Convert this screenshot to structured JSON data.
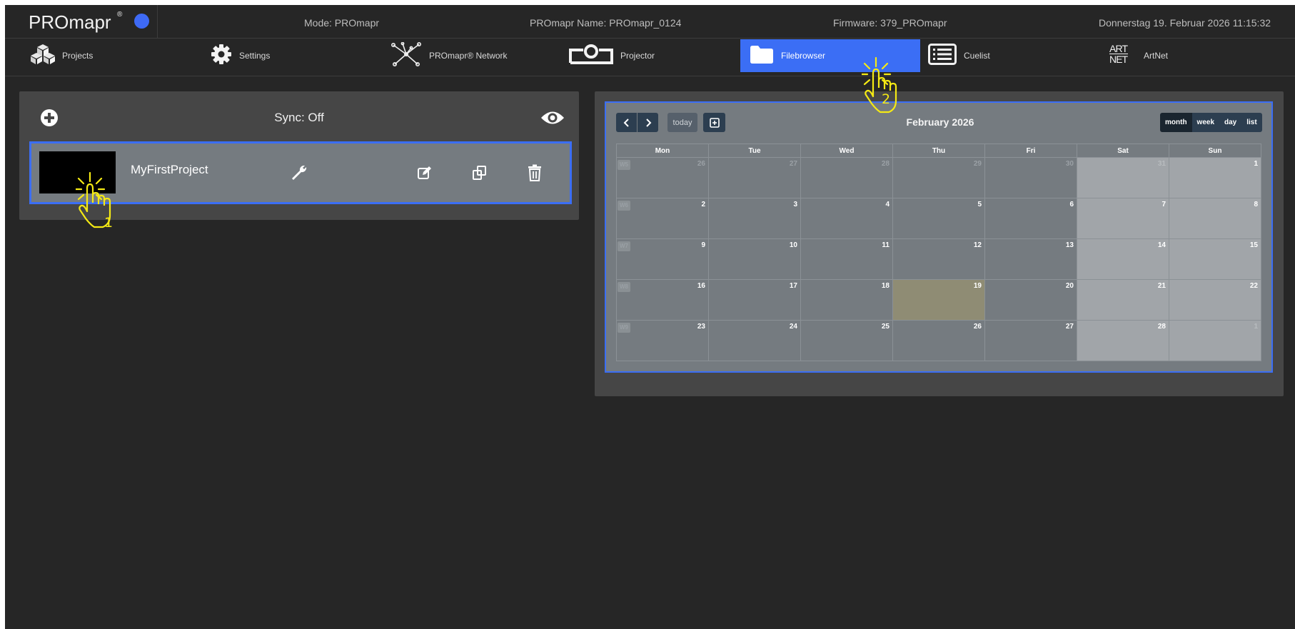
{
  "header": {
    "logo": "PROmapr",
    "logo_mark": "®",
    "mode": "Mode: PROmapr",
    "name": "PROmapr Name: PROmapr_0124",
    "firmware": "Firmware: 379_PROmapr",
    "datetime": "Donnerstag 19. Februar 2026 11:15:32",
    "status_color": "#3e6af5"
  },
  "nav": {
    "active": "Filebrowser",
    "items": [
      {
        "label": "Projects",
        "icon": "cubes-icon"
      },
      {
        "label": "Settings",
        "icon": "gear-icon"
      },
      {
        "label": "PROmapr® Network",
        "icon": "network-icon"
      },
      {
        "label": "Projector",
        "icon": "projector-icon"
      },
      {
        "label": "Filebrowser",
        "icon": "folder-icon"
      },
      {
        "label": "Cuelist",
        "icon": "list-icon"
      },
      {
        "label": "ArtNet",
        "icon": "artnet-icon"
      }
    ],
    "artnet_logo": "ART NET"
  },
  "projects": {
    "sync_label": "Sync: Off",
    "items": [
      {
        "name": "MyFirstProject"
      }
    ]
  },
  "calendar": {
    "title": "February 2026",
    "today_label": "today",
    "views": [
      "month",
      "week",
      "day",
      "list"
    ],
    "active_view": "month",
    "weekdays": [
      "Mon",
      "Tue",
      "Wed",
      "Thu",
      "Fri",
      "Sat",
      "Sun"
    ],
    "week_numbers": [
      "W5",
      "W6",
      "W7",
      "W8",
      "W9"
    ],
    "weeks": [
      [
        "26",
        "27",
        "28",
        "29",
        "30",
        "31",
        "1"
      ],
      [
        "2",
        "3",
        "4",
        "5",
        "6",
        "7",
        "8"
      ],
      [
        "9",
        "10",
        "11",
        "12",
        "13",
        "14",
        "15"
      ],
      [
        "16",
        "17",
        "18",
        "19",
        "20",
        "21",
        "22"
      ],
      [
        "23",
        "24",
        "25",
        "26",
        "27",
        "28",
        "1"
      ]
    ],
    "today": "19"
  },
  "annotations": {
    "tap1": "1",
    "tap2": "2",
    "color": "#f5ea14"
  },
  "colors": {
    "accent": "#3b6ef5",
    "background": "#262626",
    "panel": "#464646",
    "card": "#757b80"
  }
}
